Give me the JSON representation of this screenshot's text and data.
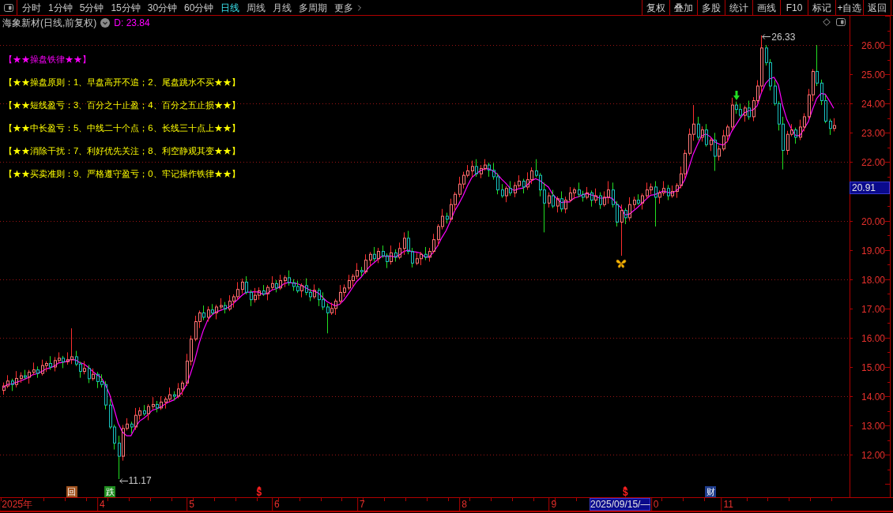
{
  "toolbar": {
    "period_tabs": [
      {
        "label": "分时",
        "selected": false
      },
      {
        "label": "1分钟",
        "selected": false
      },
      {
        "label": "5分钟",
        "selected": false
      },
      {
        "label": "15分钟",
        "selected": false
      },
      {
        "label": "30分钟",
        "selected": false
      },
      {
        "label": "60分钟",
        "selected": false
      },
      {
        "label": "日线",
        "selected": true
      },
      {
        "label": "周线",
        "selected": false
      },
      {
        "label": "月线",
        "selected": false
      },
      {
        "label": "多周期",
        "selected": false
      }
    ],
    "more_menu": {
      "label": "更多"
    },
    "buttons": [
      "复权",
      "叠加",
      "多股",
      "统计",
      "画线",
      "F10",
      "标记",
      "+自选",
      "返回"
    ]
  },
  "chart": {
    "header": {
      "title": "海象新材(日线,前复权)",
      "indicator_label": "D: 23.84"
    },
    "notes": [
      {
        "text": "【★★操盘铁律★★】",
        "color": "#ff00ff"
      },
      {
        "text": "【★★操盘原则：1、早盘高开不追；2、尾盘跳水不买★★】",
        "color": "#ffff00"
      },
      {
        "text": "【★★短线盈亏：3、百分之十止盈；4、百分之五止损★★】",
        "color": "#ffff00"
      },
      {
        "text": "【★★中长盈亏：5、中线二十个点；6、长线三十点上★★】",
        "color": "#ffff00"
      },
      {
        "text": "【★★消除干扰：7、利好优先关注；8、利空静观其变★★】",
        "color": "#ffff00"
      },
      {
        "text": "【★★买卖准则：9、严格遵守盈亏；0、牢记操作铁律★★】",
        "color": "#ffff00"
      }
    ],
    "chart_data": [
      {
        "type": "candlestick",
        "categories": [
          null,
          null,
          null,
          "2025年",
          null,
          null,
          null,
          null,
          null,
          null,
          null,
          null,
          null,
          null,
          null,
          null,
          null,
          null,
          null,
          null,
          null,
          null,
          null,
          "4",
          null,
          null,
          null,
          null,
          null,
          null,
          null,
          null,
          null,
          null,
          null,
          null,
          null,
          null,
          null,
          null,
          null,
          null,
          null,
          null,
          "5",
          null,
          null,
          null,
          null,
          null,
          null,
          null,
          null,
          null,
          null,
          null,
          null,
          null,
          null,
          null,
          null,
          null,
          null,
          null,
          "6",
          null,
          null,
          null,
          null,
          null,
          null,
          null,
          null,
          null,
          null,
          null,
          null,
          null,
          null,
          null,
          null,
          null,
          null,
          null,
          "7",
          null,
          null,
          null,
          null,
          null,
          null,
          null,
          null,
          null,
          null,
          null,
          null,
          null,
          null,
          null,
          null,
          null,
          null,
          null,
          null,
          null,
          null,
          null,
          "8",
          null,
          null,
          null,
          null,
          null,
          null,
          null,
          null,
          null,
          null,
          null,
          null,
          null,
          null,
          null,
          null,
          null,
          null,
          null,
          null,
          "9",
          null,
          null,
          null,
          null,
          null,
          null,
          null,
          null,
          null,
          null,
          null,
          null,
          null,
          null,
          null,
          null,
          null,
          null,
          null,
          null,
          null,
          null,
          null,
          "0",
          null,
          null,
          null,
          null,
          null,
          null,
          null,
          null,
          null,
          null,
          null,
          null,
          null,
          null,
          null,
          null,
          "11",
          null,
          null,
          null,
          null,
          null,
          null,
          null,
          null,
          null,
          null,
          null,
          null,
          null,
          null,
          null,
          null,
          null,
          null,
          null,
          null,
          null,
          null,
          null,
          null,
          null
        ],
        "ohlc": [
          [
            14.2,
            14.47,
            14.05,
            14.35
          ],
          [
            14.35,
            14.72,
            14.28,
            14.52
          ],
          [
            14.52,
            14.6,
            14.18,
            14.4
          ],
          [
            14.4,
            14.86,
            14.3,
            14.61
          ],
          [
            14.61,
            14.82,
            14.46,
            14.7
          ],
          [
            14.7,
            14.9,
            14.58,
            14.65
          ],
          [
            14.65,
            14.9,
            14.43,
            14.82
          ],
          [
            14.82,
            15.15,
            14.72,
            14.9
          ],
          [
            14.9,
            15.02,
            14.63,
            14.78
          ],
          [
            14.78,
            15.25,
            14.71,
            15.05
          ],
          [
            15.05,
            15.2,
            14.83,
            15.12
          ],
          [
            15.12,
            15.37,
            14.9,
            15.0
          ],
          [
            15.0,
            15.34,
            14.85,
            15.22
          ],
          [
            15.22,
            15.5,
            15.15,
            15.3
          ],
          [
            15.3,
            15.38,
            14.96,
            15.18
          ],
          [
            15.18,
            15.5,
            15.08,
            15.25
          ],
          [
            15.25,
            16.32,
            15.1,
            15.35
          ],
          [
            15.35,
            15.55,
            15.03,
            15.1
          ],
          [
            15.1,
            15.18,
            14.63,
            14.85
          ],
          [
            14.85,
            15.2,
            14.75,
            14.95
          ],
          [
            14.95,
            15.07,
            14.45,
            14.6
          ],
          [
            14.6,
            14.95,
            14.53,
            14.75
          ],
          [
            14.75,
            14.83,
            14.28,
            14.5
          ],
          [
            14.5,
            14.75,
            14.3,
            14.4
          ],
          [
            14.4,
            14.52,
            13.55,
            13.7
          ],
          [
            13.7,
            13.9,
            12.88,
            12.95
          ],
          [
            12.95,
            13.03,
            12.18,
            12.4
          ],
          [
            12.4,
            12.65,
            11.17,
            11.95
          ],
          [
            11.95,
            13.02,
            11.8,
            12.9
          ],
          [
            12.9,
            13.25,
            12.83,
            13.05
          ],
          [
            13.05,
            13.13,
            12.73,
            12.95
          ],
          [
            12.95,
            13.6,
            12.85,
            13.35
          ],
          [
            13.35,
            13.62,
            13.2,
            13.5
          ],
          [
            13.5,
            13.7,
            13.33,
            13.4
          ],
          [
            13.4,
            13.73,
            13.18,
            13.65
          ],
          [
            13.65,
            13.97,
            13.55,
            13.72
          ],
          [
            13.72,
            13.84,
            13.45,
            13.6
          ],
          [
            13.6,
            14.0,
            13.53,
            13.8
          ],
          [
            13.8,
            13.98,
            13.58,
            13.9
          ],
          [
            13.9,
            14.3,
            13.8,
            14.05
          ],
          [
            14.05,
            14.17,
            13.85,
            14.0
          ],
          [
            14.0,
            14.45,
            13.93,
            14.25
          ],
          [
            14.25,
            14.53,
            14.03,
            14.45
          ],
          [
            14.45,
            15.45,
            14.35,
            15.2
          ],
          [
            15.2,
            16.07,
            15.05,
            15.95
          ],
          [
            15.95,
            16.75,
            15.88,
            16.55
          ],
          [
            16.55,
            16.93,
            16.33,
            16.85
          ],
          [
            16.85,
            17.1,
            16.6,
            16.7
          ],
          [
            16.7,
            17.07,
            16.55,
            16.95
          ],
          [
            16.95,
            17.15,
            16.78,
            16.85
          ],
          [
            16.85,
            17.13,
            16.63,
            17.05
          ],
          [
            17.05,
            17.35,
            16.95,
            17.1
          ],
          [
            17.1,
            17.22,
            16.83,
            16.98
          ],
          [
            16.98,
            17.45,
            16.91,
            17.25
          ],
          [
            17.25,
            17.48,
            17.03,
            17.4
          ],
          [
            17.4,
            17.9,
            17.3,
            17.65
          ],
          [
            17.65,
            18.02,
            17.5,
            17.9
          ],
          [
            17.9,
            18.1,
            17.48,
            17.55
          ],
          [
            17.55,
            17.63,
            17.08,
            17.3
          ],
          [
            17.3,
            17.7,
            17.2,
            17.45
          ],
          [
            17.45,
            17.72,
            17.3,
            17.6
          ],
          [
            17.6,
            17.8,
            17.43,
            17.5
          ],
          [
            17.5,
            17.8,
            17.28,
            17.72
          ],
          [
            17.72,
            18.1,
            17.62,
            17.85
          ],
          [
            17.85,
            17.97,
            17.55,
            17.7
          ],
          [
            17.7,
            18.15,
            17.63,
            17.95
          ],
          [
            17.95,
            18.13,
            17.73,
            18.05
          ],
          [
            18.05,
            18.3,
            17.78,
            17.88
          ],
          [
            17.88,
            18.0,
            17.6,
            17.75
          ],
          [
            17.75,
            17.95,
            17.53,
            17.6
          ],
          [
            17.6,
            17.86,
            17.38,
            17.78
          ],
          [
            17.78,
            18.03,
            17.45,
            17.55
          ],
          [
            17.55,
            17.67,
            17.25,
            17.4
          ],
          [
            17.4,
            17.82,
            17.33,
            17.62
          ],
          [
            17.62,
            17.7,
            17.08,
            17.3
          ],
          [
            17.3,
            17.55,
            16.95,
            17.05
          ],
          [
            17.05,
            17.17,
            16.15,
            16.85
          ],
          [
            16.85,
            17.2,
            16.78,
            17.0
          ],
          [
            17.0,
            17.33,
            16.78,
            17.25
          ],
          [
            17.25,
            17.8,
            17.15,
            17.55
          ],
          [
            17.55,
            17.82,
            17.4,
            17.7
          ],
          [
            17.7,
            18.15,
            17.63,
            17.95
          ],
          [
            17.95,
            18.18,
            17.73,
            18.1
          ],
          [
            18.1,
            18.55,
            18.0,
            18.3
          ],
          [
            18.3,
            18.42,
            18.1,
            18.25
          ],
          [
            18.25,
            18.85,
            18.18,
            18.65
          ],
          [
            18.65,
            18.93,
            18.43,
            18.85
          ],
          [
            18.85,
            19.1,
            18.6,
            18.7
          ],
          [
            18.7,
            19.07,
            18.55,
            18.95
          ],
          [
            18.95,
            19.15,
            18.73,
            18.8
          ],
          [
            18.8,
            18.88,
            18.38,
            18.6
          ],
          [
            18.6,
            19.15,
            18.5,
            18.9
          ],
          [
            18.9,
            19.02,
            18.6,
            18.75
          ],
          [
            18.75,
            19.25,
            18.68,
            19.05
          ],
          [
            19.05,
            19.6,
            18.83,
            19.4
          ],
          [
            19.4,
            19.65,
            18.85,
            18.95
          ],
          [
            18.95,
            19.07,
            18.4,
            18.55
          ],
          [
            18.55,
            18.9,
            18.48,
            18.7
          ],
          [
            18.7,
            18.93,
            18.48,
            18.85
          ],
          [
            18.85,
            19.1,
            18.65,
            18.75
          ],
          [
            18.75,
            19.07,
            18.6,
            18.95
          ],
          [
            18.95,
            19.55,
            18.88,
            19.35
          ],
          [
            19.35,
            19.88,
            19.13,
            19.8
          ],
          [
            19.8,
            20.4,
            19.7,
            20.15
          ],
          [
            20.15,
            20.27,
            19.9,
            20.05
          ],
          [
            20.05,
            20.75,
            19.98,
            20.55
          ],
          [
            20.55,
            20.98,
            20.33,
            20.9
          ],
          [
            20.9,
            21.5,
            20.8,
            21.25
          ],
          [
            21.25,
            21.67,
            21.1,
            21.55
          ],
          [
            21.55,
            21.9,
            21.48,
            21.7
          ],
          [
            21.7,
            22.05,
            21.48,
            21.85
          ],
          [
            21.85,
            22.1,
            21.5,
            21.6
          ],
          [
            21.6,
            21.9,
            21.45,
            21.78
          ],
          [
            21.78,
            22.1,
            21.71,
            21.9
          ],
          [
            21.9,
            21.98,
            21.5,
            21.72
          ],
          [
            21.72,
            21.97,
            21.4,
            21.5
          ],
          [
            21.5,
            21.62,
            20.9,
            21.05
          ],
          [
            21.05,
            21.25,
            20.78,
            20.85
          ],
          [
            20.85,
            21.18,
            20.63,
            21.1
          ],
          [
            21.1,
            21.35,
            20.85,
            20.95
          ],
          [
            20.95,
            21.32,
            20.8,
            21.2
          ],
          [
            21.2,
            21.55,
            21.13,
            21.35
          ],
          [
            21.35,
            21.43,
            20.93,
            21.15
          ],
          [
            21.15,
            21.65,
            21.05,
            21.4
          ],
          [
            21.4,
            21.82,
            21.25,
            21.7
          ],
          [
            21.7,
            22.1,
            21.48,
            21.55
          ],
          [
            21.55,
            21.63,
            20.83,
            21.05
          ],
          [
            21.05,
            21.3,
            19.6,
            20.6
          ],
          [
            20.6,
            20.97,
            20.45,
            20.85
          ],
          [
            20.85,
            21.05,
            20.43,
            20.5
          ],
          [
            20.5,
            20.83,
            20.28,
            20.75
          ],
          [
            20.75,
            21.0,
            20.3,
            20.4
          ],
          [
            20.4,
            20.82,
            20.25,
            20.7
          ],
          [
            20.7,
            21.15,
            20.63,
            20.95
          ],
          [
            20.95,
            21.13,
            20.73,
            21.05
          ],
          [
            21.05,
            21.3,
            20.8,
            20.9
          ],
          [
            20.9,
            21.02,
            20.65,
            20.8
          ],
          [
            20.8,
            21.15,
            20.73,
            20.95
          ],
          [
            20.95,
            21.03,
            20.48,
            20.7
          ],
          [
            20.7,
            21.1,
            20.6,
            20.85
          ],
          [
            20.85,
            20.97,
            20.4,
            20.55
          ],
          [
            20.55,
            21.0,
            20.48,
            20.8
          ],
          [
            20.8,
            21.35,
            20.58,
            21.05
          ],
          [
            21.05,
            21.3,
            20.45,
            20.55
          ],
          [
            20.55,
            20.67,
            19.8,
            19.95
          ],
          [
            19.95,
            20.55,
            18.8,
            20.35
          ],
          [
            20.35,
            20.43,
            19.88,
            20.1
          ],
          [
            20.1,
            20.8,
            20.0,
            20.55
          ],
          [
            20.55,
            20.82,
            20.4,
            20.7
          ],
          [
            20.7,
            20.9,
            20.53,
            20.6
          ],
          [
            20.6,
            20.93,
            20.38,
            20.85
          ],
          [
            20.85,
            21.3,
            20.75,
            21.05
          ],
          [
            21.05,
            21.27,
            20.9,
            21.15
          ],
          [
            21.15,
            21.35,
            19.8,
            20.8
          ],
          [
            20.8,
            21.03,
            20.58,
            20.95
          ],
          [
            20.95,
            21.35,
            20.85,
            21.1
          ],
          [
            21.1,
            21.22,
            20.7,
            20.85
          ],
          [
            20.85,
            21.2,
            20.78,
            21.0
          ],
          [
            21.0,
            21.28,
            20.78,
            21.2
          ],
          [
            21.2,
            21.85,
            21.1,
            21.6
          ],
          [
            21.6,
            22.42,
            21.45,
            22.3
          ],
          [
            22.3,
            23.15,
            22.23,
            22.95
          ],
          [
            22.95,
            23.95,
            22.73,
            23.3
          ],
          [
            23.3,
            23.55,
            22.75,
            22.85
          ],
          [
            22.85,
            23.22,
            22.7,
            23.1
          ],
          [
            23.1,
            23.3,
            22.53,
            22.6
          ],
          [
            22.6,
            22.83,
            22.38,
            22.75
          ],
          [
            22.75,
            23.0,
            21.7,
            22.2
          ],
          [
            22.2,
            22.57,
            22.05,
            22.45
          ],
          [
            22.45,
            23.1,
            22.38,
            22.9
          ],
          [
            22.9,
            23.28,
            22.68,
            23.2
          ],
          [
            23.2,
            24.2,
            23.1,
            23.95
          ],
          [
            23.95,
            24.07,
            23.65,
            23.8
          ],
          [
            23.8,
            24.0,
            23.53,
            23.6
          ],
          [
            23.6,
            23.93,
            23.38,
            23.85
          ],
          [
            23.85,
            24.1,
            23.45,
            23.55
          ],
          [
            23.55,
            24.22,
            23.4,
            24.1
          ],
          [
            24.1,
            24.8,
            24.03,
            24.6
          ],
          [
            24.6,
            26.33,
            24.38,
            25.9
          ],
          [
            25.9,
            26.0,
            25.3,
            25.4
          ],
          [
            25.4,
            25.52,
            24.45,
            24.6
          ],
          [
            24.6,
            24.8,
            23.93,
            24.0
          ],
          [
            24.0,
            24.08,
            23.08,
            23.3
          ],
          [
            23.3,
            23.55,
            21.75,
            22.4
          ],
          [
            22.4,
            23.07,
            22.25,
            22.95
          ],
          [
            22.95,
            23.3,
            22.88,
            23.1
          ],
          [
            23.1,
            23.18,
            22.63,
            22.85
          ],
          [
            22.85,
            23.45,
            22.75,
            23.2
          ],
          [
            23.2,
            23.67,
            23.05,
            23.55
          ],
          [
            23.55,
            24.5,
            23.48,
            24.3
          ],
          [
            24.3,
            25.18,
            24.08,
            25.1
          ],
          [
            25.1,
            26.0,
            24.6,
            24.7
          ],
          [
            24.7,
            24.82,
            23.95,
            24.1
          ],
          [
            24.1,
            24.3,
            23.33,
            23.4
          ],
          [
            23.4,
            23.48,
            22.93,
            23.15
          ],
          [
            23.15,
            23.5,
            23.05,
            23.25
          ]
        ],
        "series": [
          {
            "type": "line",
            "color": "#ff00ff",
            "values": [
              14.3,
              14.4,
              14.42,
              14.47,
              14.52,
              14.58,
              14.64,
              14.74,
              14.77,
              14.84,
              14.93,
              14.97,
              15.03,
              15.14,
              15.16,
              15.19,
              15.26,
              15.24,
              15.15,
              15.1,
              14.99,
              14.85,
              14.73,
              14.64,
              14.39,
              14.06,
              13.59,
              13.08,
              12.78,
              12.65,
              12.65,
              12.93,
              13.15,
              13.25,
              13.37,
              13.52,
              13.57,
              13.63,
              13.73,
              13.81,
              13.87,
              13.98,
              14.13,
              14.39,
              14.77,
              15.24,
              15.8,
              16.25,
              16.6,
              16.78,
              16.88,
              16.93,
              16.99,
              17.05,
              17.16,
              17.3,
              17.44,
              17.55,
              17.56,
              17.57,
              17.56,
              17.48,
              17.51,
              17.62,
              17.67,
              17.74,
              17.85,
              17.89,
              17.87,
              17.85,
              17.79,
              17.71,
              17.62,
              17.59,
              17.53,
              17.38,
              17.24,
              17.16,
              17.09,
              17.14,
              17.29,
              17.49,
              17.71,
              17.92,
              18.06,
              18.25,
              18.43,
              18.55,
              18.68,
              18.79,
              18.78,
              18.79,
              18.76,
              18.82,
              18.94,
              18.99,
              18.94,
              18.93,
              18.89,
              18.76,
              18.76,
              18.92,
              19.14,
              19.42,
              19.66,
              19.98,
              20.33,
              20.58,
              20.86,
              21.19,
              21.47,
              21.6,
              21.7,
              21.77,
              21.77,
              21.7,
              21.59,
              21.42,
              21.28,
              21.11,
              21.03,
              21.09,
              21.11,
              21.21,
              21.36,
              21.43,
              21.37,
              21.26,
              21.15,
              20.91,
              20.75,
              20.62,
              20.64,
              20.64,
              20.77,
              20.81,
              20.88,
              20.93,
              20.88,
              20.84,
              20.77,
              20.77,
              20.8,
              20.76,
              20.58,
              20.45,
              20.2,
              20.22,
              20.34,
              20.46,
              20.6,
              20.74,
              20.87,
              20.89,
              20.96,
              21.01,
              20.97,
              20.94,
              21.02,
              21.15,
              21.39,
              21.81,
              22.27,
              22.6,
              22.9,
              22.96,
              22.87,
              22.7,
              22.62,
              22.58,
              22.7,
              23.04,
              23.26,
              23.49,
              23.68,
              23.75,
              23.78,
              23.92,
              24.37,
              24.69,
              24.85,
              24.9,
              24.64,
              23.94,
              23.45,
              23.15,
              22.92,
              22.9,
              23.13,
              23.37,
              23.8,
              24.17,
              24.35,
              24.32,
              24.09,
              23.84
            ]
          }
        ],
        "ylim": [
          10.55,
          27
        ],
        "yticks": [
          {
            "value": 12,
            "label": "12.00"
          },
          {
            "value": 13,
            "label": "13.00"
          },
          {
            "value": 14,
            "label": "14.00"
          },
          {
            "value": 15,
            "label": "15.00"
          },
          {
            "value": 16,
            "label": "16.00"
          },
          {
            "value": 17,
            "label": "17.00"
          },
          {
            "value": 18,
            "label": "18.00"
          },
          {
            "value": 19,
            "label": "19.00"
          },
          {
            "value": 20,
            "label": "20.00"
          },
          {
            "value": 22,
            "label": "22.00"
          },
          {
            "value": 23,
            "label": "23.00"
          },
          {
            "value": 24,
            "label": "24.00"
          },
          {
            "value": 25,
            "label": "25.00"
          },
          {
            "value": 26,
            "label": "26.00"
          }
        ],
        "grid": true,
        "annotations": [
          "26.33",
          "11.17"
        ]
      }
    ],
    "event_tags": [
      {
        "kind": "tag",
        "text": "回",
        "color": "#a0521e"
      },
      {
        "kind": "tag",
        "text": "跌",
        "color": "#1e8c1e"
      },
      {
        "kind": "dollar",
        "text": "$",
        "color": "#ff2020"
      },
      {
        "kind": "dollar",
        "text": "$",
        "color": "#ff2020"
      },
      {
        "kind": "tag",
        "text": "财",
        "color": "#1e3c8c"
      }
    ],
    "cursor": {
      "date_label": "2025/09/15/—",
      "price_label": "20.91"
    }
  }
}
